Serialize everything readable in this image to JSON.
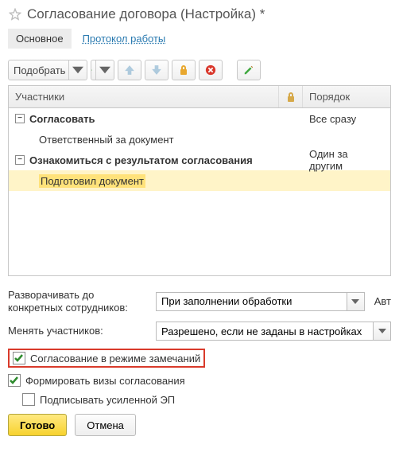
{
  "header": {
    "title": "Согласование договора (Настройка) *"
  },
  "tabs": {
    "main": "Основное",
    "log": "Протокол работы"
  },
  "toolbar": {
    "select": "Подобрать"
  },
  "grid": {
    "headers": {
      "participants": "Участники",
      "order": "Порядок"
    },
    "rows": [
      {
        "type": "group",
        "label": "Согласовать",
        "order": "Все сразу"
      },
      {
        "type": "child",
        "label": "Ответственный за документ",
        "order": ""
      },
      {
        "type": "group",
        "label": "Ознакомиться с результатом согласования",
        "order": "Один за другим"
      },
      {
        "type": "child",
        "label": "Подготовил документ",
        "order": "",
        "selected": true
      }
    ]
  },
  "form": {
    "expandLabel": "Разворачивать до конкретных сотрудников:",
    "expandValue": "При заполнении обработки",
    "expandTrailing": "Авт",
    "changeLabel": "Менять участников:",
    "changeValue": "Разрешено, если не заданы в настройках"
  },
  "checkboxes": {
    "remarks": "Согласование в режиме замечаний",
    "visas": "Формировать визы согласования",
    "signEP": "Подписывать усиленной ЭП"
  },
  "buttons": {
    "ok": "Готово",
    "cancel": "Отмена"
  }
}
